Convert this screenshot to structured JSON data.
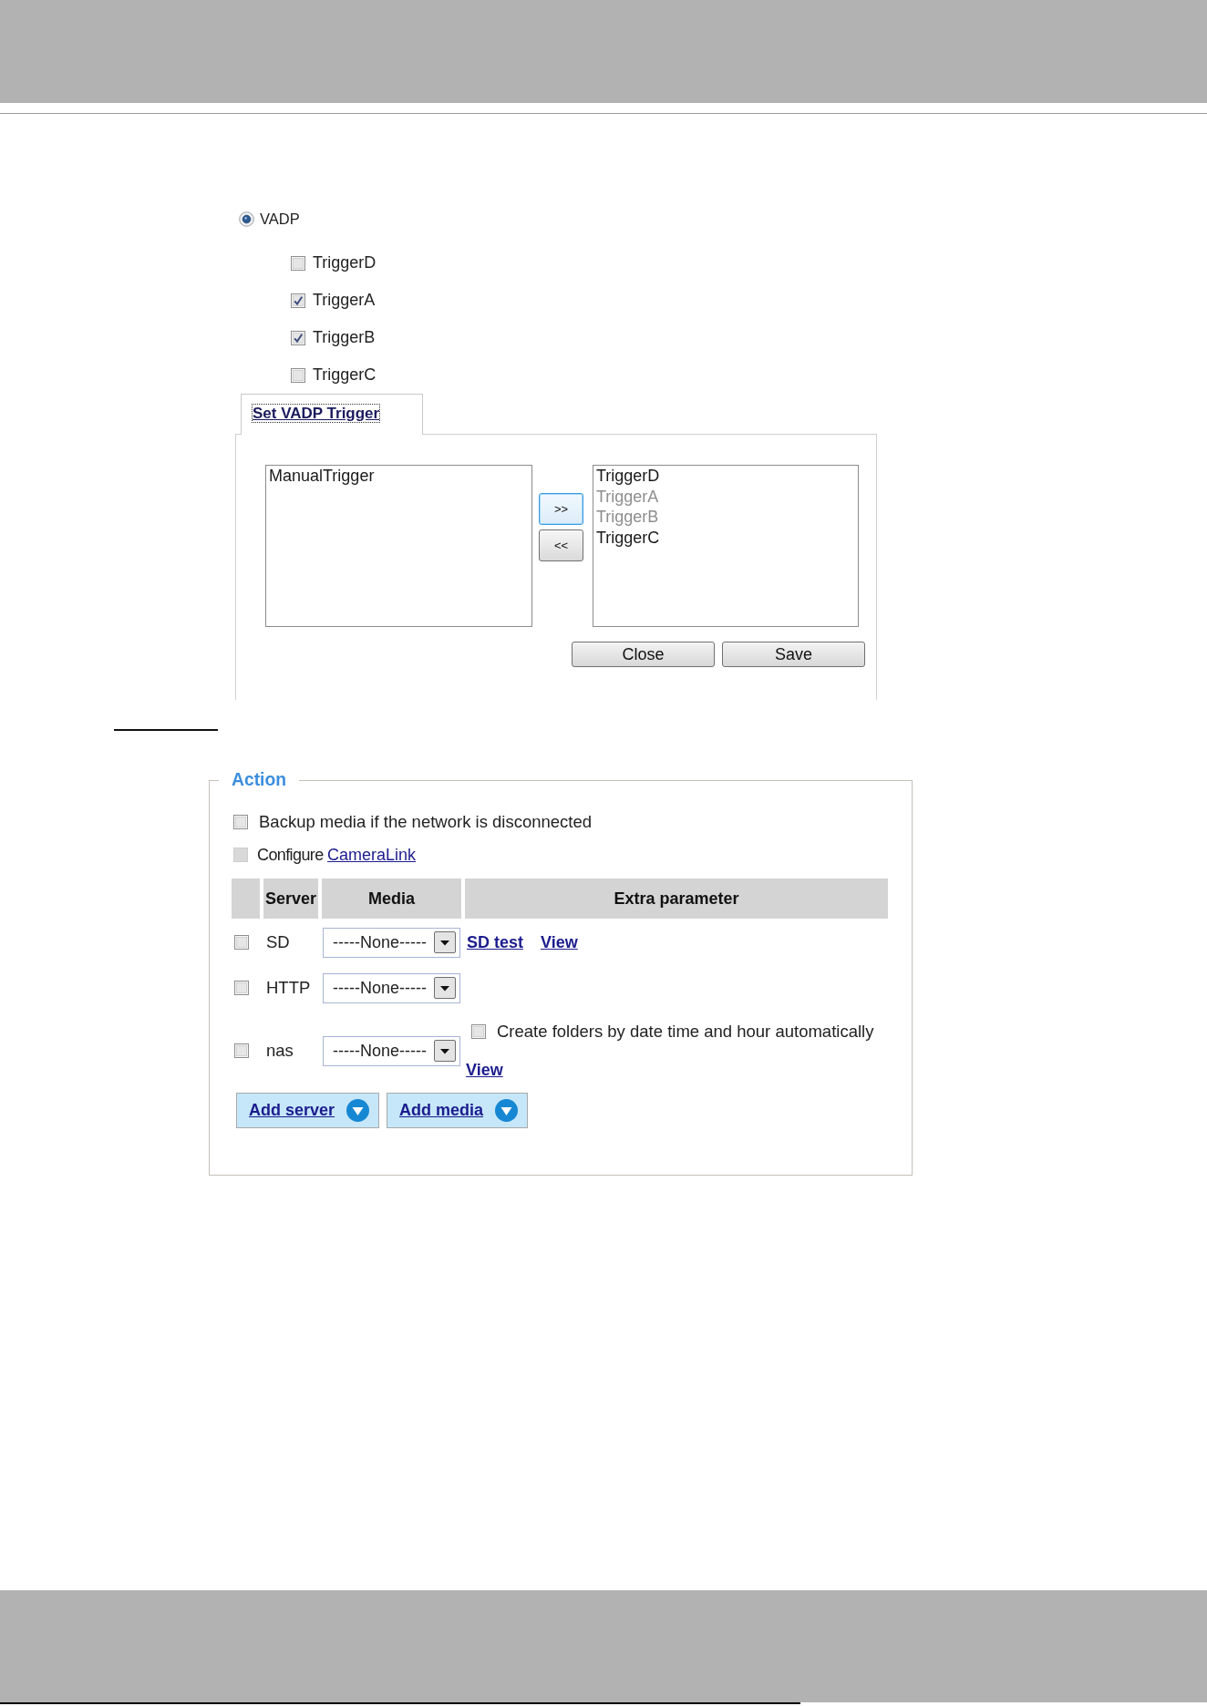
{
  "vadp": {
    "label": "VADP",
    "selected": true
  },
  "triggers": [
    {
      "label": "TriggerD",
      "checked": false
    },
    {
      "label": "TriggerA",
      "checked": true
    },
    {
      "label": "TriggerB",
      "checked": true
    },
    {
      "label": "TriggerC",
      "checked": false
    }
  ],
  "trigger_dialog": {
    "tab": {
      "label": "Set VADP Trigger",
      "selected": true
    },
    "available": [
      {
        "label": "ManualTrigger",
        "disabled": false
      }
    ],
    "move_buttons": [
      {
        "label": ">>",
        "focused": true
      },
      {
        "label": "<<",
        "focused": false
      }
    ],
    "chosen": [
      {
        "label": "TriggerD",
        "disabled": false
      },
      {
        "label": "TriggerA",
        "disabled": true
      },
      {
        "label": "TriggerB",
        "disabled": true
      },
      {
        "label": "TriggerC",
        "disabled": false
      }
    ],
    "buttons": [
      "Close",
      "Save"
    ]
  },
  "action": {
    "legend": "Action",
    "backup": {
      "label": "Backup media if the network is disconnected",
      "checked": false
    },
    "configure": {
      "label": "Configure",
      "link": "CameraLink",
      "checked": false,
      "disabled": true
    },
    "table": {
      "columns": [
        "Server",
        "Media",
        "Extra parameter"
      ],
      "rows": [
        {
          "server": "SD",
          "checked": false,
          "media": "-----None-----",
          "links": [
            "SD test",
            "View"
          ]
        },
        {
          "server": "HTTP",
          "checked": false,
          "media": "-----None-----"
        },
        {
          "server": "nas",
          "checked": false,
          "media": "-----None-----",
          "option": {
            "label": "Create folders by date time and hour automatically",
            "checked": false
          },
          "links": [
            "View"
          ]
        }
      ]
    },
    "add_buttons": [
      "Add server",
      "Add media"
    ]
  }
}
